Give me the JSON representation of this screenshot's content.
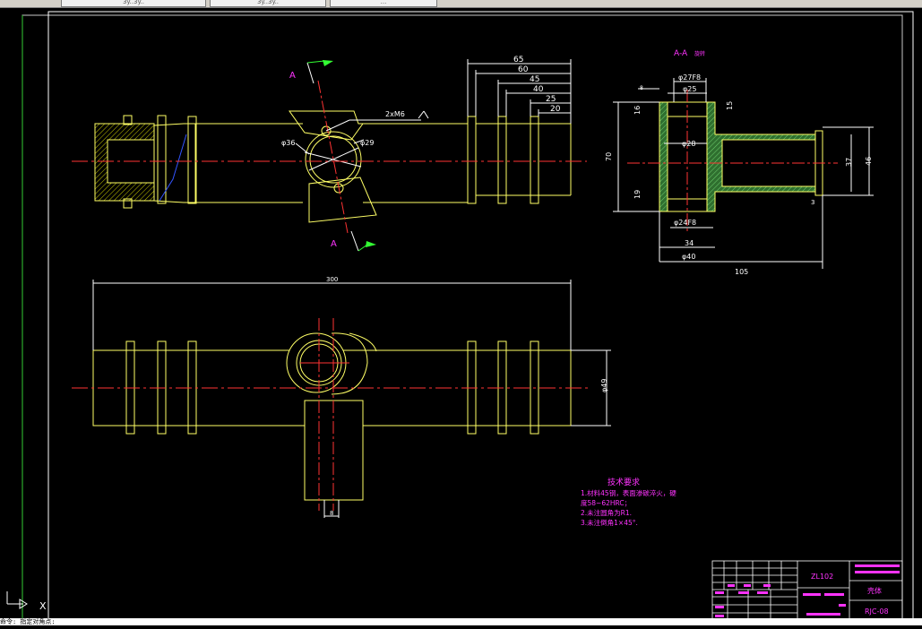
{
  "tabs": [
    "3y..3y..",
    "3y..3y..",
    "..."
  ],
  "drawing": {
    "section_label": "A-A",
    "section_note": "旋转",
    "cut_marker": "A",
    "side_dims": [
      "65",
      "60",
      "45",
      "40",
      "25",
      "20"
    ],
    "hole_note": "2xM6",
    "dia_36": "φ36",
    "dia_29": "φ29",
    "dia_27f8": "φ27F8",
    "dia_25": "φ25",
    "dia_28": "φ28",
    "dia_24f8": "φ24F8",
    "dim_34": "34",
    "dia_40": "φ40",
    "dim_105": "105",
    "dim_70": "70",
    "dim_16": "16",
    "dim_19": "19",
    "dim_37": "37",
    "dim_46": "46",
    "dim_15": "15",
    "dim_8": "8",
    "dim_3": "3",
    "length_300": "300",
    "dia_49": "φ49"
  },
  "tech": {
    "title": "技术要求",
    "lines": [
      "1.材料45钢，表面渗碳淬火，硬",
      "  度58~62HRC；",
      "2.未注圆角为R1.",
      "3.未注倒角1×45°."
    ]
  },
  "titleblock": {
    "code": "ZL102",
    "name": "壳体",
    "number": "RJC-08"
  },
  "cmdline": {
    "text": "命令: 指定对角点:"
  },
  "ucs": {
    "y": "Y",
    "x": "X"
  }
}
